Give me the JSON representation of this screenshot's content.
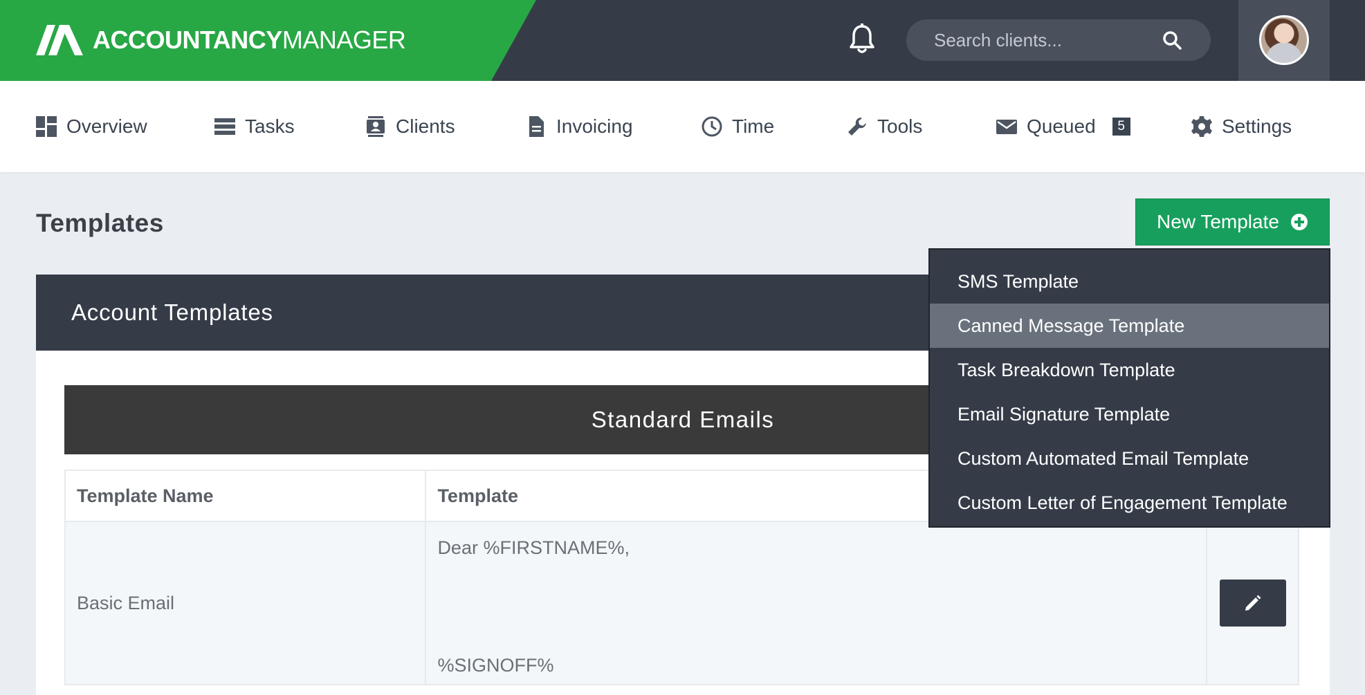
{
  "header": {
    "brand_bold": "ACCOUNTANCY",
    "brand_light": "MANAGER",
    "search_placeholder": "Search clients..."
  },
  "nav": {
    "items": [
      {
        "label": "Overview",
        "icon": "dashboard-icon"
      },
      {
        "label": "Tasks",
        "icon": "tasks-icon"
      },
      {
        "label": "Clients",
        "icon": "contacts-icon"
      },
      {
        "label": "Invoicing",
        "icon": "document-icon"
      },
      {
        "label": "Time",
        "icon": "clock-icon"
      },
      {
        "label": "Tools",
        "icon": "wrench-icon"
      },
      {
        "label": "Queued",
        "icon": "envelope-icon",
        "badge": "5"
      },
      {
        "label": "Settings",
        "icon": "gear-icon"
      }
    ]
  },
  "page": {
    "title": "Templates",
    "new_button": "New Template"
  },
  "dropdown": {
    "items": [
      "SMS Template",
      "Canned Message Template",
      "Task Breakdown Template",
      "Email Signature Template",
      "Custom Automated Email Template",
      "Custom Letter of Engagement Template"
    ],
    "highlighted": "Canned Message Template"
  },
  "panel": {
    "title": "Account Templates",
    "section": "Standard Emails",
    "columns": [
      "Template Name",
      "Template"
    ],
    "rows": [
      {
        "name": "Basic Email",
        "template_line1": "Dear %FIRSTNAME%,",
        "template_line2": "%SIGNOFF%"
      }
    ]
  },
  "colors": {
    "brand_green": "#28a745",
    "header_dark": "#353c48",
    "button_green": "#17a05d",
    "dropdown_highlight": "#68717c"
  }
}
